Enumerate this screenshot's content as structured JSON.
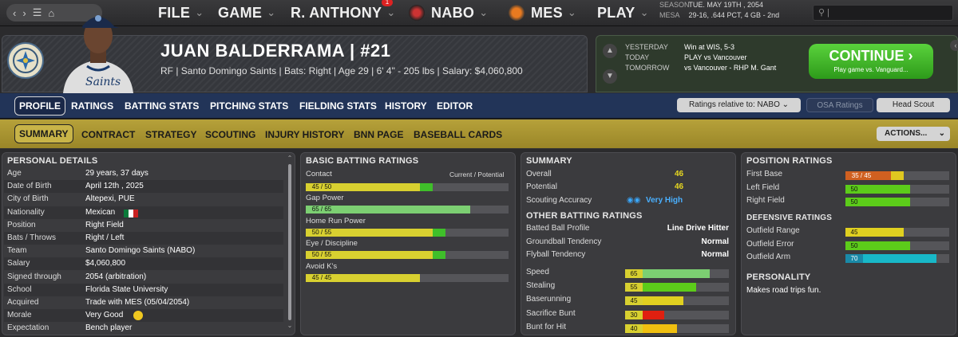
{
  "topbar": {
    "menus": [
      {
        "label": "FILE"
      },
      {
        "label": "GAME"
      },
      {
        "label": "R. ANTHONY",
        "badge": "1"
      },
      {
        "label": "NABO"
      },
      {
        "label": "MES"
      },
      {
        "label": "PLAY"
      }
    ],
    "season_label": "SEASON",
    "season_date": "TUE. MAY 19TH , 2054",
    "team_label": "MESA",
    "team_record": "29-16, .644 PCT, 4 GB - 2nd",
    "search_placeholder": "|"
  },
  "player": {
    "name": "JUAN BALDERRAMA  |  #21",
    "info": "RF | Santo Domingo Saints   |   Bats: Right   |   Age 29   |   6' 4\" - 205 lbs   |   Salary: $4,060,800"
  },
  "game": {
    "rows": [
      {
        "label": "YESTERDAY",
        "value": "Win at WIS, 5-3"
      },
      {
        "label": "TODAY",
        "value": "PLAY vs Vancouver"
      },
      {
        "label": "TOMORROW",
        "value": "vs Vancouver - RHP M. Gant"
      }
    ],
    "continue_label": "CONTINUE ›",
    "continue_sub": "Play game vs. Vanguard..."
  },
  "tabs_primary": [
    "PROFILE",
    "RATINGS",
    "BATTING STATS",
    "PITCHING STATS",
    "FIELDING STATS",
    "HISTORY",
    "EDITOR"
  ],
  "ratings_relative": "Ratings relative to: NABO",
  "osa_ratings": "OSA Ratings",
  "head_scout": "Head Scout",
  "tabs_secondary": [
    "SUMMARY",
    "CONTRACT",
    "STRATEGY",
    "SCOUTING",
    "INJURY HISTORY",
    "BNN PAGE",
    "BASEBALL CARDS"
  ],
  "actions_label": "ACTIONS...",
  "personal": {
    "title": "PERSONAL DETAILS",
    "rows": [
      {
        "k": "Age",
        "v": "29 years, 37 days"
      },
      {
        "k": "Date of Birth",
        "v": "April 12th , 2025"
      },
      {
        "k": "City of Birth",
        "v": "Altepexi, PUE"
      },
      {
        "k": "Nationality",
        "v": "Mexican"
      },
      {
        "k": "Position",
        "v": "Right Field"
      },
      {
        "k": "Bats / Throws",
        "v": "Right / Left"
      },
      {
        "k": "Team",
        "v": "Santo Domingo Saints (NABO)"
      },
      {
        "k": "Salary",
        "v": "$4,060,800"
      },
      {
        "k": "Signed through",
        "v": "2054 (arbitration)"
      },
      {
        "k": "School",
        "v": "Florida State University"
      },
      {
        "k": "Acquired",
        "v": "Trade with MES (05/04/2054)"
      },
      {
        "k": "Morale",
        "v": "Very Good"
      },
      {
        "k": "Expectation",
        "v": "Bench player"
      }
    ]
  },
  "batting": {
    "title": "BASIC BATTING RATINGS",
    "header_right": "Current / Potential",
    "bars": [
      {
        "label": "Contact",
        "text": "45 / 50",
        "current": 45,
        "potential": 50
      },
      {
        "label": "Gap Power",
        "text": "65 / 65",
        "current": 65,
        "potential": 65
      },
      {
        "label": "Home Run Power",
        "text": "50 / 55",
        "current": 50,
        "potential": 55
      },
      {
        "label": "Eye / Discipline",
        "text": "50 / 55",
        "current": 50,
        "potential": 55
      },
      {
        "label": "Avoid K's",
        "text": "45 / 45",
        "current": 45,
        "potential": 45
      }
    ],
    "scale_max": 80
  },
  "summary": {
    "title": "SUMMARY",
    "overall_label": "Overall",
    "overall": "46",
    "potential_label": "Potential",
    "potential": "46",
    "scouting_label": "Scouting Accuracy",
    "scouting": "Very High",
    "other_title": "OTHER BATTING RATINGS",
    "other": [
      {
        "k": "Batted Ball Profile",
        "v": "Line Drive Hitter"
      },
      {
        "k": "Groundball Tendency",
        "v": "Normal"
      },
      {
        "k": "Flyball Tendency",
        "v": "Normal"
      }
    ],
    "running": [
      {
        "k": "Speed",
        "v": 65,
        "color": "#7ccf72"
      },
      {
        "k": "Stealing",
        "v": 55,
        "color": "#5ccc1a"
      },
      {
        "k": "Baserunning",
        "v": 45,
        "color": "#e0d020"
      },
      {
        "k": "Sacrifice Bunt",
        "v": 30,
        "color": "#e02010"
      },
      {
        "k": "Bunt for Hit",
        "v": 40,
        "color": "#f0c010"
      }
    ]
  },
  "position": {
    "title": "POSITION RATINGS",
    "rows": [
      {
        "k": "First Base",
        "text": "35 / 45",
        "current": 35,
        "potential": 45,
        "color": "#d06020"
      },
      {
        "k": "Left Field",
        "text": "50",
        "current": 50,
        "potential": 50,
        "color": "#5ccc1a"
      },
      {
        "k": "Right Field",
        "text": "50",
        "current": 50,
        "potential": 50,
        "color": "#5ccc1a"
      }
    ],
    "def_title": "DEFENSIVE RATINGS",
    "def": [
      {
        "k": "Outfield Range",
        "text": "45",
        "v": 45,
        "color": "#e0d020"
      },
      {
        "k": "Outfield Error",
        "text": "50",
        "v": 50,
        "color": "#5ccc1a"
      },
      {
        "k": "Outfield Arm",
        "text": "70",
        "v": 70,
        "color": "#18b8c8"
      }
    ],
    "personality_title": "PERSONALITY",
    "personality": "Makes road trips fun."
  }
}
